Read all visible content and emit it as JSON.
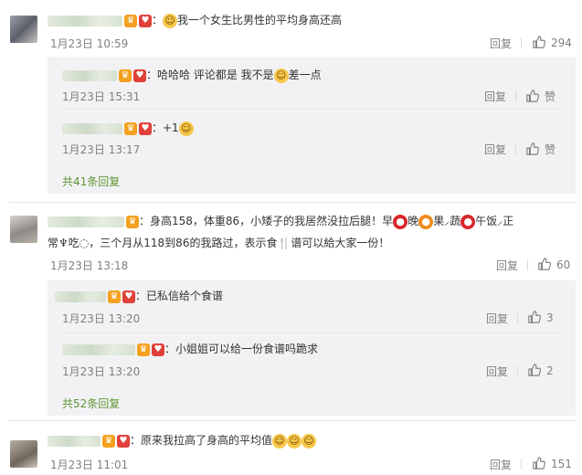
{
  "comments": [
    {
      "text": "：",
      "text_after_emoji": "我一个女生比男性的平均身高还高",
      "date": "1月23日 10:59",
      "reply": "回复",
      "likes": "294",
      "subs": [
        {
          "text_pre": "：哈哈哈 评论都是 我不是",
          "text_post": "差一点",
          "date": "1月23日 15:31",
          "reply": "回复",
          "like": "赞"
        },
        {
          "text_pre": "：+1",
          "text_post": "",
          "date": "1月23日 13:17",
          "reply": "回复",
          "like": "赞"
        }
      ],
      "more": "共41条回复"
    },
    {
      "text_line1_a": "：身高158，体重86，小矮子的我居然没拉后腿！早",
      "text_line1_b": "晚",
      "text_line1_c": "果",
      "text_line1_d": "蔬",
      "text_line1_e": "午饭",
      "text_line1_f": "正",
      "text_line2": "常",
      "text_line2_b": "吃",
      "text_line2_c": "，三个月从118到86的我路过，表示食",
      "text_line2_d": "谱可以給大家一份！",
      "date": "1月23日 13:18",
      "reply": "回复",
      "likes": "60",
      "subs": [
        {
          "text_pre": "：已私信给个食谱",
          "date": "1月23日 13:20",
          "reply": "回复",
          "likes": "3"
        },
        {
          "text_pre": "：小姐姐可以给一份食谱吗跪求",
          "date": "1月23日 13:20",
          "reply": "回复",
          "likes": "2"
        }
      ],
      "more": "共52条回复"
    },
    {
      "text": "：原来我拉高了身高的平均值",
      "date": "1月23日 11:01",
      "reply": "回复",
      "likes": "151"
    }
  ],
  "colors": {
    "link_green": "#5f9632",
    "muted": "#808080",
    "sub_bg": "#f2f2f5"
  }
}
